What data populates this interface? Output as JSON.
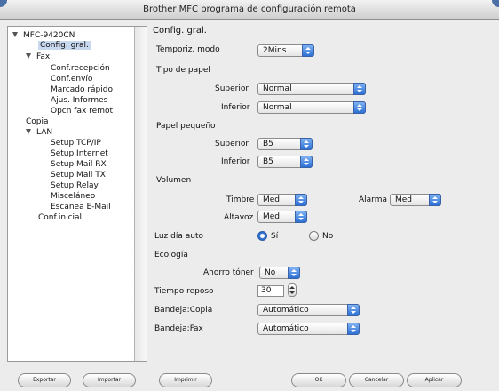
{
  "window": {
    "title": "Brother MFC programa de configuración remota"
  },
  "tree": {
    "items": [
      {
        "label": "MFC-9420CN"
      },
      {
        "label": "Config. gral."
      },
      {
        "label": "Fax"
      },
      {
        "label": "Conf.recepción"
      },
      {
        "label": "Conf.envío"
      },
      {
        "label": "Marcado rápido"
      },
      {
        "label": "Ajus. Informes"
      },
      {
        "label": "Opcn fax remot"
      },
      {
        "label": "Copia"
      },
      {
        "label": "LAN"
      },
      {
        "label": "Setup TCP/IP"
      },
      {
        "label": "Setup Internet"
      },
      {
        "label": "Setup Mail RX"
      },
      {
        "label": "Setup Mail TX"
      },
      {
        "label": "Setup Relay"
      },
      {
        "label": "Misceláneo"
      },
      {
        "label": "Escanea E-Mail"
      },
      {
        "label": "Conf.inicial"
      }
    ]
  },
  "panel": {
    "title": "Config. gral.",
    "temporiz_label": "Temporiz. modo",
    "temporiz_value": "2Mins",
    "tipo_papel_label": "Tipo de papel",
    "superior_label": "Superior",
    "superior_value": "Normal",
    "inferior_label": "Inferior",
    "inferior_value": "Normal",
    "papel_pequeno_label": "Papel pequeño",
    "pp_superior_label": "Superior",
    "pp_superior_value": "B5",
    "pp_inferior_label": "Inferior",
    "pp_inferior_value": "B5",
    "volumen_label": "Volumen",
    "timbre_label": "Timbre",
    "timbre_value": "Med",
    "alarma_label": "Alarma",
    "alarma_value": "Med",
    "altavoz_label": "Altavoz",
    "altavoz_value": "Med",
    "luz_label": "Luz día auto",
    "si_label": "Sí",
    "no_label": "No",
    "ecologia_label": "Ecología",
    "ahorro_label": "Ahorro tóner",
    "ahorro_value": "No",
    "tiempo_label": "Tiempo reposo",
    "tiempo_value": "30",
    "bandeja_copia_label": "Bandeja:Copia",
    "bandeja_copia_value": "Automático",
    "bandeja_fax_label": "Bandeja:Fax",
    "bandeja_fax_value": "Automático"
  },
  "buttons": {
    "exportar": "Exportar",
    "importar": "Importar",
    "imprimir": "Imprimir",
    "ok": "OK",
    "cancelar": "Cancelar",
    "aplicar": "Aplicar"
  }
}
